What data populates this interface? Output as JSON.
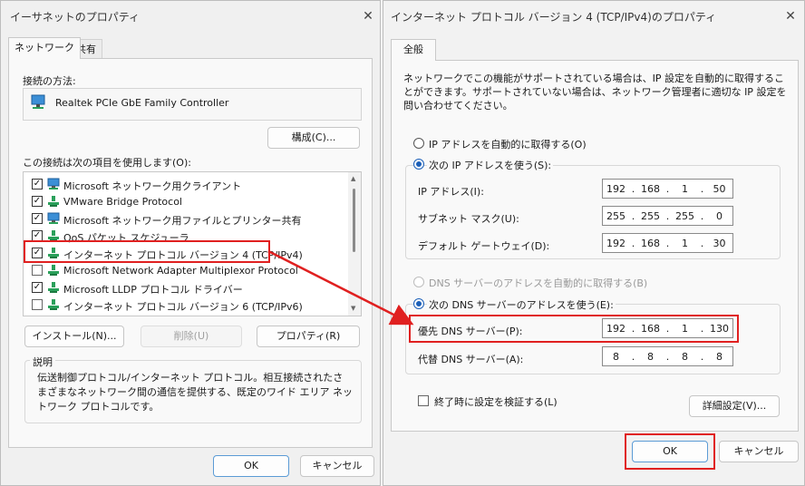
{
  "left_dialog": {
    "title": "イーサネットのプロパティ",
    "tabs": [
      "ネットワーク",
      "共有"
    ],
    "connect_using_label": "接続の方法:",
    "adapter_name": "Realtek PCIe GbE Family Controller",
    "configure_button": "構成(C)...",
    "items_label": "この接続は次の項目を使用します(O):",
    "items": [
      {
        "label": "Microsoft ネットワーク用クライアント",
        "checked": true,
        "icon": "network-client-icon"
      },
      {
        "label": "VMware Bridge Protocol",
        "checked": true,
        "icon": "protocol-icon"
      },
      {
        "label": "Microsoft ネットワーク用ファイルとプリンター共有",
        "checked": true,
        "icon": "network-client-icon"
      },
      {
        "label": "QoS パケット スケジューラ",
        "checked": true,
        "icon": "protocol-icon"
      },
      {
        "label": "インターネット プロトコル バージョン 4 (TCP/IPv4)",
        "checked": true,
        "icon": "protocol-icon"
      },
      {
        "label": "Microsoft Network Adapter Multiplexor Protocol",
        "checked": false,
        "icon": "protocol-icon"
      },
      {
        "label": "Microsoft LLDP プロトコル ドライバー",
        "checked": true,
        "icon": "protocol-icon"
      },
      {
        "label": "インターネット プロトコル バージョン 6 (TCP/IPv6)",
        "checked": false,
        "icon": "protocol-icon"
      }
    ],
    "install_button": "インストール(N)...",
    "uninstall_button": "削除(U)",
    "properties_button": "プロパティ(R)",
    "description_label": "説明",
    "description_text": "伝送制御プロトコル/インターネット プロトコル。相互接続されたさまざまなネットワーク間の通信を提供する、既定のワイド エリア ネットワーク プロトコルです。",
    "ok_button": "OK",
    "cancel_button": "キャンセル"
  },
  "right_dialog": {
    "title": "インターネット プロトコル バージョン 4 (TCP/IPv4)のプロパティ",
    "tab": "全般",
    "intro_text": "ネットワークでこの機能がサポートされている場合は、IP 設定を自動的に取得することができます。サポートされていない場合は、ネットワーク管理者に適切な IP 設定を問い合わせてください。",
    "ip_auto_label": "IP アドレスを自動的に取得する(O)",
    "ip_manual_label": "次の IP アドレスを使う(S):",
    "ip_address_label": "IP アドレス(I):",
    "ip_address": [
      "192",
      "168",
      "1",
      "50"
    ],
    "subnet_label": "サブネット マスク(U):",
    "subnet_mask": [
      "255",
      "255",
      "255",
      "0"
    ],
    "gateway_label": "デフォルト ゲートウェイ(D):",
    "gateway": [
      "192",
      "168",
      "1",
      "30"
    ],
    "dns_auto_label": "DNS サーバーのアドレスを自動的に取得する(B)",
    "dns_manual_label": "次の DNS サーバーのアドレスを使う(E):",
    "preferred_dns_label": "優先 DNS サーバー(P):",
    "preferred_dns": [
      "192",
      "168",
      "1",
      "130"
    ],
    "alternate_dns_label": "代替 DNS サーバー(A):",
    "alternate_dns": [
      "8",
      "8",
      "8",
      "8"
    ],
    "validate_label": "終了時に設定を検証する(L)",
    "advanced_button": "詳細設定(V)...",
    "ok_button": "OK",
    "cancel_button": "キャンセル"
  },
  "colors": {
    "highlight_red": "#e02020",
    "radio_blue": "#1b5fb8"
  }
}
